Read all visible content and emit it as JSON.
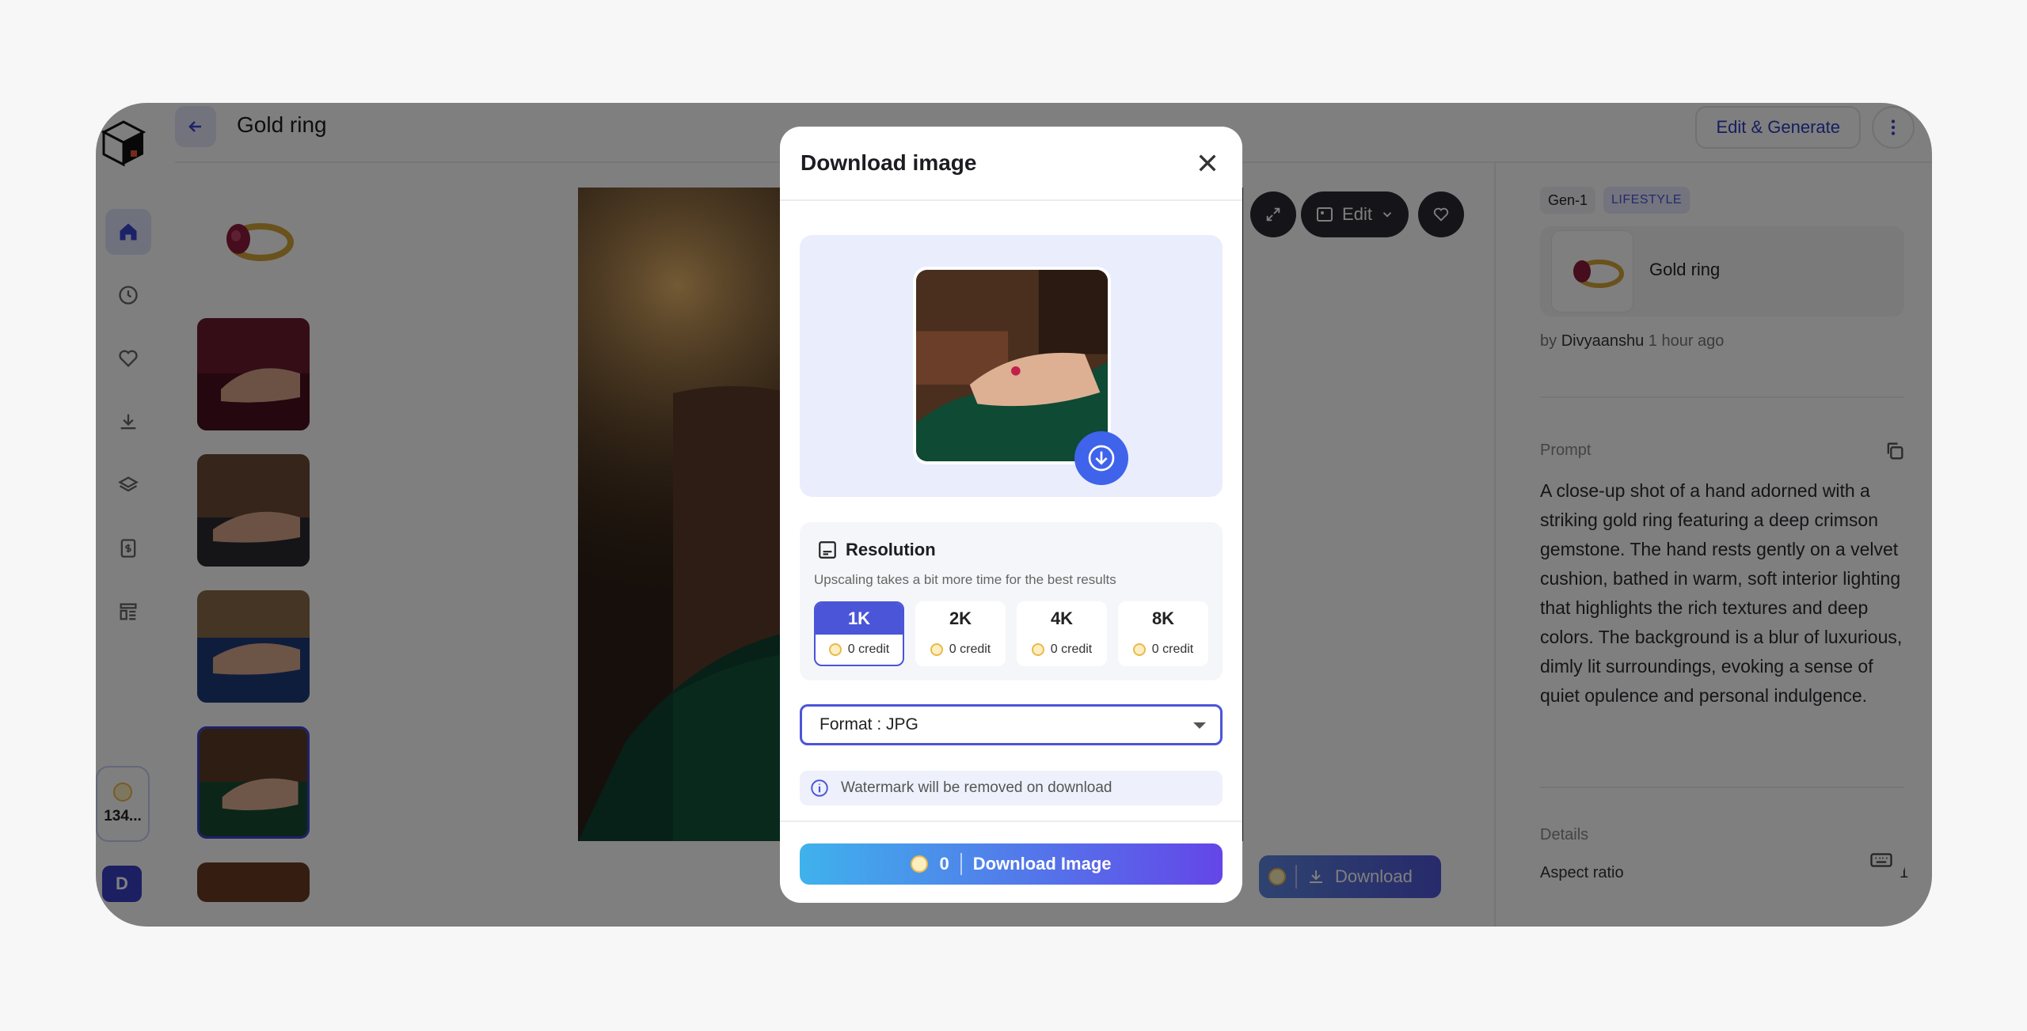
{
  "header": {
    "title": "Gold ring",
    "edit_generate_label": "Edit & Generate"
  },
  "sidebar": {
    "credits_count": "134...",
    "avatar_initial": "D",
    "icons": [
      "home-icon",
      "clock-icon",
      "heart-icon",
      "download-icon",
      "layers-icon",
      "billing-icon",
      "layout-icon"
    ]
  },
  "toolbar": {
    "edit_label": "Edit",
    "download_label": "Download"
  },
  "details": {
    "model_badge": "Gen-1",
    "style_badge": "LIFESTYLE",
    "product_name": "Gold ring",
    "by_prefix": "by",
    "author": "Divyaanshu",
    "time_ago": "1 hour ago",
    "prompt_label": "Prompt",
    "prompt_text": "A close-up shot of a hand adorned with a striking gold ring featuring a deep crimson gemstone. The hand rests gently on a velvet cushion, bathed in warm, soft interior lighting that highlights the rich textures and deep colors. The background is a blur of luxurious, dimly lit surroundings, evoking a sense of quiet opulence and personal indulgence.",
    "details_label": "Details",
    "aspect_ratio_label": "Aspect ratio",
    "aspect_ratio_value": "1"
  },
  "modal": {
    "title": "Download image",
    "resolution": {
      "title": "Resolution",
      "subtitle": "Upscaling takes a bit more time for the best results",
      "options": [
        {
          "label": "1K",
          "cost": "0 credit",
          "selected": true
        },
        {
          "label": "2K",
          "cost": "0 credit",
          "selected": false
        },
        {
          "label": "4K",
          "cost": "0 credit",
          "selected": false
        },
        {
          "label": "8K",
          "cost": "0 credit",
          "selected": false
        }
      ]
    },
    "format_value": "Format : JPG",
    "watermark_note": "Watermark will be removed on download",
    "download_cost": "0",
    "download_label": "Download Image"
  },
  "colors": {
    "accent": "#4a55d8",
    "coin": "#e9b94a",
    "overlay": "rgba(0,0,0,0.5)"
  }
}
